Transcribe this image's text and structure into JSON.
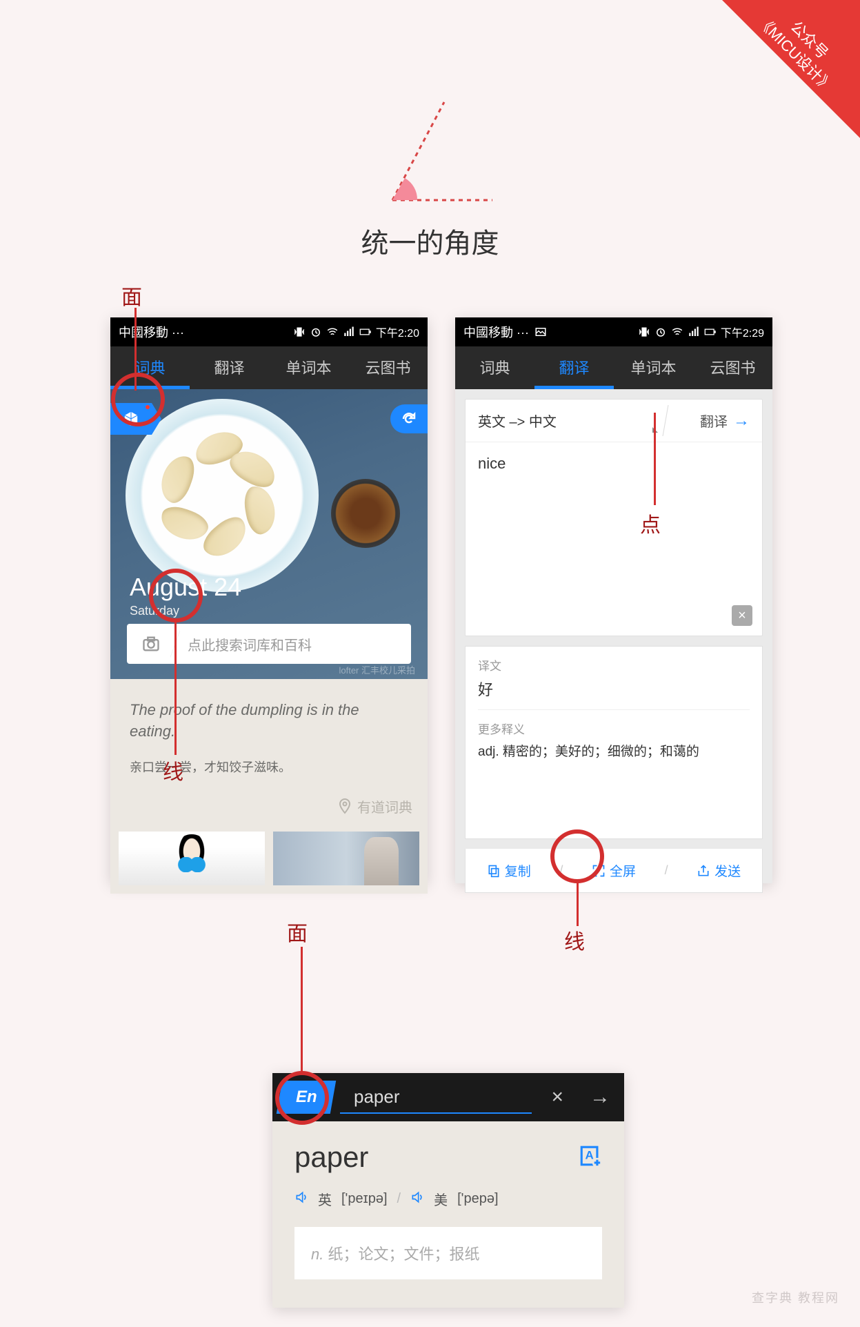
{
  "ribbon": {
    "line1": "公众号",
    "line2": "《MICU设计》"
  },
  "page_title": "统一的角度",
  "annotations": {
    "face1": "面",
    "line1": "线",
    "point": "点",
    "line2": "线",
    "face2": "面"
  },
  "phone1": {
    "status": {
      "carrier": "中國移動 ···",
      "time": "下午2:20"
    },
    "tabs": [
      "词典",
      "翻译",
      "单词本",
      "云图书"
    ],
    "active_tab": 0,
    "hero": {
      "date": "August 24",
      "day": "Saturday",
      "search_placeholder": "点此搜索词库和百科",
      "lofter": "lofter 汇丰校儿采拍"
    },
    "quote": {
      "en": "The proof of the dumpling is in the eating.",
      "cn": "亲口尝一尝，才知饺子滋味。"
    },
    "brand": "有道词典"
  },
  "phone2": {
    "status": {
      "carrier": "中國移動 ···",
      "time": "下午2:29"
    },
    "tabs": [
      "词典",
      "翻译",
      "单词本",
      "云图书"
    ],
    "active_tab": 1,
    "trans": {
      "lang_pair": "英文 –> 中文",
      "go_label": "翻译",
      "input": "nice"
    },
    "result": {
      "label1": "译文",
      "val1": "好",
      "label2": "更多释义",
      "val2": "adj. 精密的；美好的；细微的；和蔼的"
    },
    "actions": {
      "copy": "复制",
      "full": "全屏",
      "send": "发送"
    }
  },
  "phone3": {
    "badge": "En",
    "search_value": "paper",
    "word": "paper",
    "pron_uk_label": "英",
    "pron_uk": "['peɪpə]",
    "pron_us_label": "美",
    "pron_us": "['pepə]",
    "def_pos": "n.",
    "def": "纸；论文；文件；报纸"
  },
  "watermark": "查字典 教程网"
}
